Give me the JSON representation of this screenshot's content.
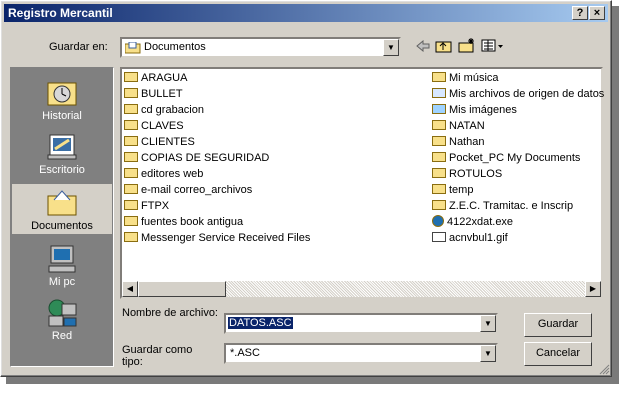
{
  "window": {
    "title": "Registro Mercantil",
    "help_label": "?",
    "close_label": "×"
  },
  "toolbar": {
    "lookin_label": "Guardar en:",
    "lookin_value": "Documentos",
    "back_icon": "back-arrow-icon",
    "up_icon": "up-folder-icon",
    "newfolder_icon": "new-folder-icon",
    "view_icon": "view-menu-icon"
  },
  "places": [
    {
      "label": "Historial",
      "icon": "history-icon"
    },
    {
      "label": "Escritorio",
      "icon": "desktop-icon"
    },
    {
      "label": "Documentos",
      "icon": "documents-icon",
      "selected": true
    },
    {
      "label": "Mi pc",
      "icon": "computer-icon"
    },
    {
      "label": "Red",
      "icon": "network-icon"
    }
  ],
  "files_col1": [
    "ARAGUA",
    "BULLET",
    "cd grabacion",
    "CLAVES",
    "CLIENTES",
    "COPIAS DE SEGURIDAD",
    "editores web",
    "e-mail correo_archivos",
    "FTPX",
    "fuentes book antigua",
    "Messenger Service Received Files"
  ],
  "files_col2": [
    "Mi música",
    "Mis archivos de origen de datos",
    "Mis imágenes",
    "NATAN",
    "Nathan",
    "Pocket_PC My Documents",
    "ROTULOS",
    "temp",
    "Z.E.C. Tramitac. e Inscrip",
    "4122xdat.exe",
    "acnvbul1.gif"
  ],
  "form": {
    "filename_label": "Nombre de archivo:",
    "filename_value": "DATOS.ASC",
    "type_label": "Guardar como tipo:",
    "type_value": "*.ASC",
    "save_label": "Guardar",
    "cancel_label": "Cancelar"
  },
  "colors": {
    "title_start": "#0a246a",
    "title_end": "#a6caf0",
    "face": "#d4d0c8",
    "selection": "#0a246a"
  }
}
